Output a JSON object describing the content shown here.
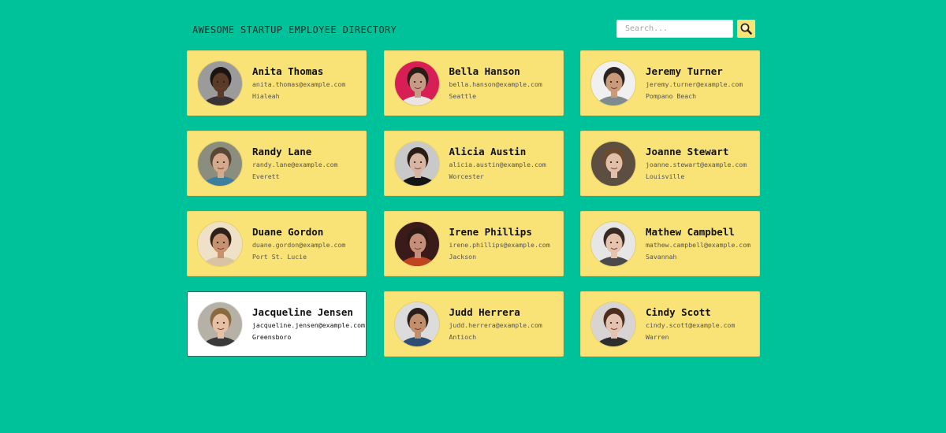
{
  "header": {
    "title": "AWESOME STARTUP EMPLOYEE DIRECTORY",
    "search_placeholder": "Search...",
    "search_value": "",
    "search_icon": "magnifier-icon"
  },
  "colors": {
    "background": "#00c29a",
    "card": "#f9e276",
    "card_selected": "#ffffff",
    "search_button": "#f8e377"
  },
  "employees": [
    {
      "name": "Anita Thomas",
      "email": "anita.thomas@example.com",
      "city": "Hialeah",
      "selected": false,
      "photo_bg": "#9b9b9b",
      "skin": "#5a3a28",
      "hair": "#1a1412",
      "shirt": "#3b3333"
    },
    {
      "name": "Bella Hanson",
      "email": "bella.hanson@example.com",
      "city": "Seattle",
      "selected": false,
      "photo_bg": "#d81f55",
      "skin": "#c69a85",
      "hair": "#2b1c17",
      "shirt": "#ece4e0"
    },
    {
      "name": "Jeremy Turner",
      "email": "jeremy.turner@example.com",
      "city": "Pompano Beach",
      "selected": false,
      "photo_bg": "#f0f0f0",
      "skin": "#c99b7b",
      "hair": "#2b2320",
      "shirt": "#7f8a8e"
    },
    {
      "name": "Randy Lane",
      "email": "randy.lane@example.com",
      "city": "Everett",
      "selected": false,
      "photo_bg": "#8b8e7e",
      "skin": "#d4a98c",
      "hair": "#5a4634",
      "shirt": "#3e7f9e"
    },
    {
      "name": "Alicia Austin",
      "email": "alicia.austin@example.com",
      "city": "Worcester",
      "selected": false,
      "photo_bg": "#c9c9c9",
      "skin": "#d7b5a2",
      "hair": "#2a1b15",
      "shirt": "#151515"
    },
    {
      "name": "Joanne Stewart",
      "email": "joanne.stewart@example.com",
      "city": "Louisville",
      "selected": false,
      "photo_bg": "#5c4e40",
      "skin": "#e2bfa8",
      "hair": "#6b4a2f",
      "shirt": "#5c4e40"
    },
    {
      "name": "Duane Gordon",
      "email": "duane.gordon@example.com",
      "city": "Port St. Lucie",
      "selected": false,
      "photo_bg": "#efe1c7",
      "skin": "#c69270",
      "hair": "#2d2019",
      "shirt": "#d8c3a5"
    },
    {
      "name": "Irene Phillips",
      "email": "irene.phillips@example.com",
      "city": "Jackson",
      "selected": false,
      "photo_bg": "#3a1b1a",
      "skin": "#c58e78",
      "hair": "#2a1a12",
      "shirt": "#c14422"
    },
    {
      "name": "Mathew Campbell",
      "email": "mathew.campbell@example.com",
      "city": "Savannah",
      "selected": false,
      "photo_bg": "#e6e6e6",
      "skin": "#e6c3ad",
      "hair": "#3a2b22",
      "shirt": "#4a4a4a"
    },
    {
      "name": "Jacqueline Jensen",
      "email": "jacqueline.jensen@example.com",
      "city": "Greensboro",
      "selected": true,
      "photo_bg": "#b6b1a6",
      "skin": "#e6c0a5",
      "hair": "#8c6a3f",
      "shirt": "#3a3a3a"
    },
    {
      "name": "Judd Herrera",
      "email": "judd.herrera@example.com",
      "city": "Antioch",
      "selected": false,
      "photo_bg": "#dcdcdc",
      "skin": "#c28f6d",
      "hair": "#2b2019",
      "shirt": "#2f4d74"
    },
    {
      "name": "Cindy Scott",
      "email": "cindy.scott@example.com",
      "city": "Warren",
      "selected": false,
      "photo_bg": "#d8d4d4",
      "skin": "#e4c2b0",
      "hair": "#4a2d1e",
      "shirt": "#2e2e2e"
    }
  ]
}
